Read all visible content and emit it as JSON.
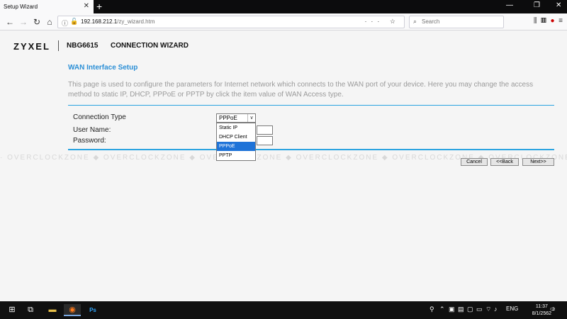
{
  "browser": {
    "tab_title": "Setup Wizard",
    "tab_close": "✕",
    "new_tab": "+",
    "window_controls": [
      "—",
      "❐",
      "✕"
    ],
    "url_host": "192.168.212.1",
    "url_path": "/zy_wizard.htm",
    "search_placeholder": "Search",
    "url_icons": "··· ☆"
  },
  "header": {
    "brand": "ZYXEL",
    "model": "NBG6615",
    "wizard_title": "CONNECTION WIZARD"
  },
  "section": {
    "title": "WAN Interface Setup",
    "description": "This page is used to configure the parameters for Internet network which connects to the WAN port of your device. Here you may change the access method to static IP, DHCP, PPPoE or PPTP by click the item value of WAN Access type."
  },
  "form": {
    "connection_type_label": "Connection Type",
    "connection_type_value": "PPPoE",
    "username_label": "User Name:",
    "password_label": "Password:",
    "options": [
      "Static IP",
      "DHCP Client",
      "PPPoE",
      "PPTP"
    ],
    "selected_option": "PPPoE"
  },
  "buttons": {
    "cancel": "Cancel",
    "back": "<<Back",
    "next": "Next>>"
  },
  "watermark": "· OVERCLOCKZONE ◆ OVERCLOCKZONE ◆ OVERCLOCKZONE ◆ OVERCLOCKZONE ◆ OVERCLOCKZONE ◆ OVERCLOCKZONE ◆ OVERCLOCKZONE",
  "taskbar": {
    "language": "ENG",
    "time": "11:37",
    "date": "8/1/2562",
    "notification_count": "2"
  },
  "colors": {
    "accent": "#2aa3e0",
    "section_title": "#2b8fd6",
    "selected_item": "#1e73d8"
  }
}
